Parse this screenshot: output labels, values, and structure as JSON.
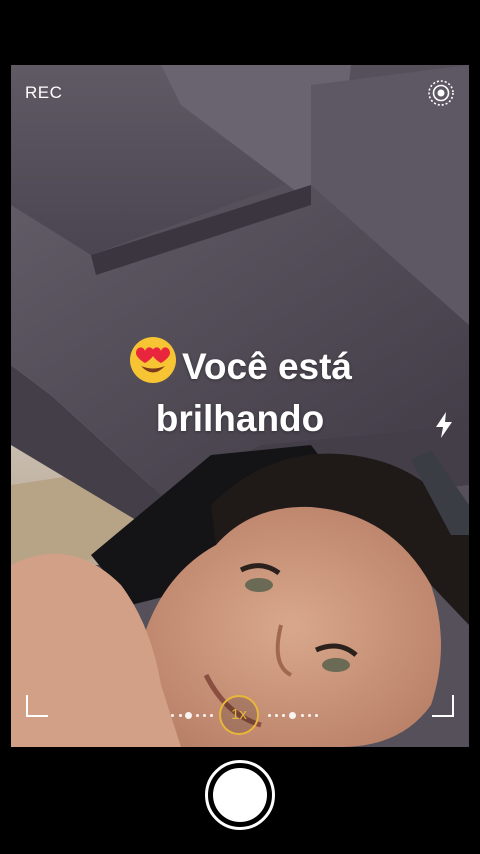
{
  "camera": {
    "rec_label": "REC",
    "caption_emoji": "heart-eyes-emoji",
    "caption_line1": "Você está",
    "caption_line2": "brilhando",
    "zoom_label": "1x",
    "zoom_color": "#e8b63a",
    "settings_icon": "live-settings-icon",
    "flash_icon": "flash-icon",
    "shutter_color": "#ffffff"
  }
}
